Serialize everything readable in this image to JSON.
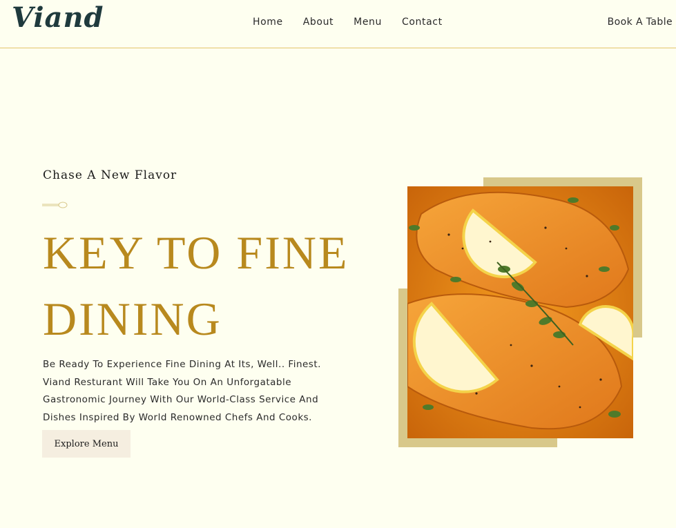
{
  "header": {
    "logo": "Viand",
    "nav": [
      "Home",
      "About",
      "Menu",
      "Contact"
    ],
    "book_label": "Book A Table"
  },
  "hero": {
    "tagline": "Chase A New Flavor",
    "title_line1": "KEY TO FINE",
    "title_line2": "DINING",
    "description": "Be Ready To Experience Fine Dining At Its, Well.. Finest. Viand Resturant Will Take You On An Unforgatable Gastronomic Journey With Our World-Class Service And Dishes Inspired By World Renowned Chefs And Cooks.",
    "button_label": "Explore Menu"
  },
  "colors": {
    "background": "#fefff0",
    "accent_gold": "#b8891e",
    "frame": "#d8c88a",
    "header_border": "#e3c36a",
    "button_bg": "#f5eee0",
    "logo": "#1f3a3d"
  },
  "icons": {
    "spoon": "spoon-divider-icon"
  }
}
